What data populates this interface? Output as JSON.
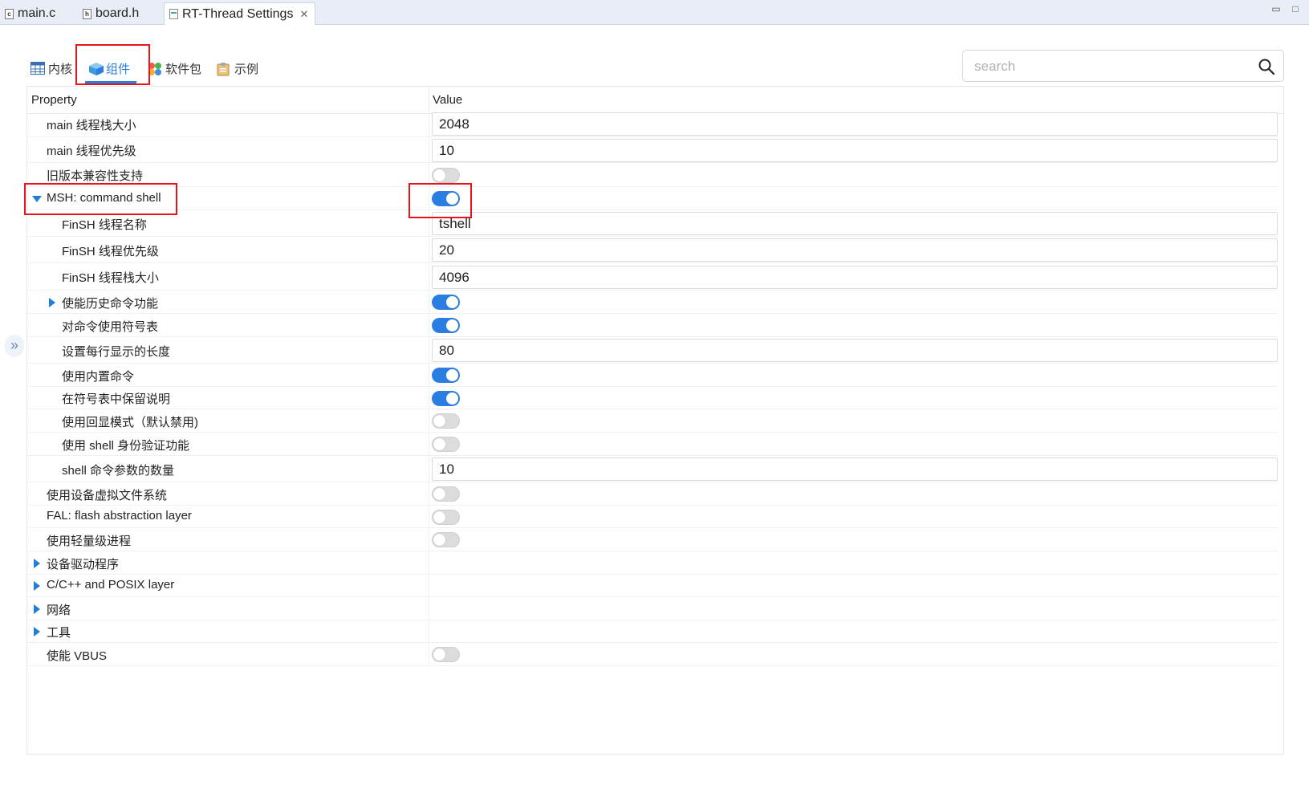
{
  "editor_tabs": [
    {
      "label": "main.c",
      "icon": "c-file-icon",
      "badge": "c"
    },
    {
      "label": "board.h",
      "icon": "h-file-icon",
      "badge": "h"
    },
    {
      "label": "RT-Thread Settings",
      "icon": "settings-file-icon",
      "badge": "",
      "close": "✕"
    }
  ],
  "window_controls": {
    "minimize": "▭",
    "maximize": "□"
  },
  "collapse_handle": "»",
  "category_tabs": [
    {
      "label": "内核",
      "icon": "kernel-table-icon"
    },
    {
      "label": "组件",
      "icon": "component-cube-icon"
    },
    {
      "label": "软件包",
      "icon": "packages-icon"
    },
    {
      "label": "示例",
      "icon": "examples-clipboard-icon"
    }
  ],
  "search": {
    "placeholder": "search",
    "icon": "search-icon"
  },
  "table": {
    "columns": {
      "property": "Property",
      "value": "Value"
    },
    "rows": [
      {
        "label": "main 线程栈大小",
        "type": "text",
        "value": "2048",
        "indent": 1
      },
      {
        "label": "main 线程优先级",
        "type": "text",
        "value": "10",
        "indent": 1
      },
      {
        "label": "旧版本兼容性支持",
        "type": "toggle",
        "on": false,
        "indent": 1
      },
      {
        "label": "MSH: command shell",
        "type": "toggle",
        "on": true,
        "indent": 1,
        "expander": "expanded"
      },
      {
        "label": "FinSH 线程名称",
        "type": "text",
        "value": "tshell",
        "indent": 2
      },
      {
        "label": "FinSH 线程优先级",
        "type": "text",
        "value": "20",
        "indent": 2
      },
      {
        "label": "FinSH 线程栈大小",
        "type": "text",
        "value": "4096",
        "indent": 2
      },
      {
        "label": "使能历史命令功能",
        "type": "toggle",
        "on": true,
        "indent": 2,
        "expander": "collapsed"
      },
      {
        "label": "对命令使用符号表",
        "type": "toggle",
        "on": true,
        "indent": 2
      },
      {
        "label": "设置每行显示的长度",
        "type": "text",
        "value": "80",
        "indent": 2
      },
      {
        "label": "使用内置命令",
        "type": "toggle",
        "on": true,
        "indent": 2
      },
      {
        "label": "在符号表中保留说明",
        "type": "toggle",
        "on": true,
        "indent": 2
      },
      {
        "label": "使用回显模式（默认禁用)",
        "type": "toggle",
        "on": false,
        "indent": 2
      },
      {
        "label": "使用 shell 身份验证功能",
        "type": "toggle",
        "on": false,
        "indent": 2
      },
      {
        "label": "shell 命令参数的数量",
        "type": "text",
        "value": "10",
        "indent": 2
      },
      {
        "label": "使用设备虚拟文件系统",
        "type": "toggle",
        "on": false,
        "indent": 1
      },
      {
        "label": "FAL: flash abstraction layer",
        "type": "toggle",
        "on": false,
        "indent": 1
      },
      {
        "label": "使用轻量级进程",
        "type": "toggle",
        "on": false,
        "indent": 1
      },
      {
        "label": "设备驱动程序",
        "type": "group",
        "indent": 1,
        "expander": "collapsed"
      },
      {
        "label": "C/C++ and POSIX layer",
        "type": "group",
        "indent": 1,
        "expander": "collapsed"
      },
      {
        "label": "网络",
        "type": "group",
        "indent": 1,
        "expander": "collapsed"
      },
      {
        "label": "工具",
        "type": "group",
        "indent": 1,
        "expander": "collapsed"
      },
      {
        "label": "使能 VBUS",
        "type": "toggle",
        "on": false,
        "indent": 1
      }
    ]
  },
  "colors": {
    "accent": "#2a7de1",
    "highlight_box": "#e8141b",
    "toggle_off": "#dcdcdc"
  }
}
